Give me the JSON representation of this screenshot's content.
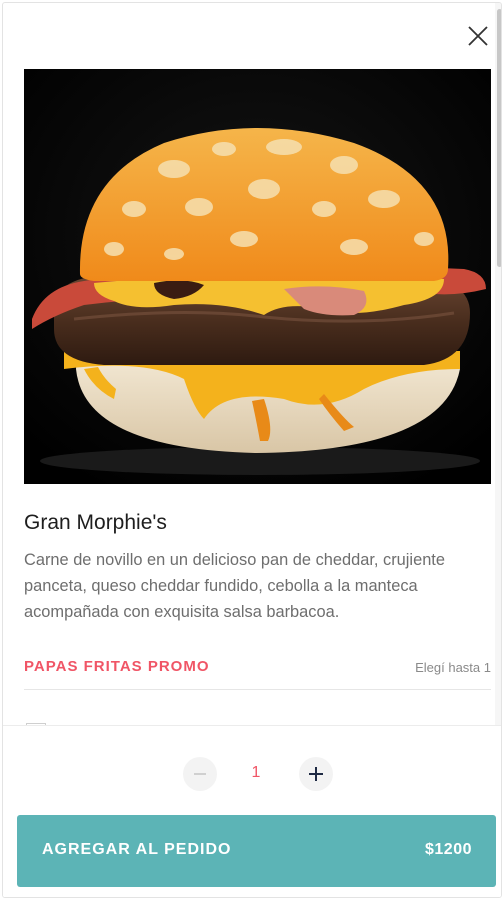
{
  "modal": {
    "close_icon": "close-icon"
  },
  "product": {
    "image_subject": "burger-image",
    "name": "Gran Morphie's",
    "description": "Carne de novillo en un delicioso pan de cheddar, crujiente panceta, queso cheddar fundido, cebolla a la manteca acompañada con exquisita salsa barbacoa."
  },
  "options_section": {
    "title": "PAPAS FRITAS PROMO",
    "limit": "Elegí hasta 1"
  },
  "footer": {
    "minus_icon": "minus-icon",
    "plus_icon": "plus-icon",
    "quantity": "1",
    "add_label": "AGREGAR AL PEDIDO",
    "price": "$1200"
  },
  "colors": {
    "accent": "#f05566",
    "button": "#5cb4b6",
    "text": "#1e1e1e",
    "muted": "#6e6e6e"
  }
}
